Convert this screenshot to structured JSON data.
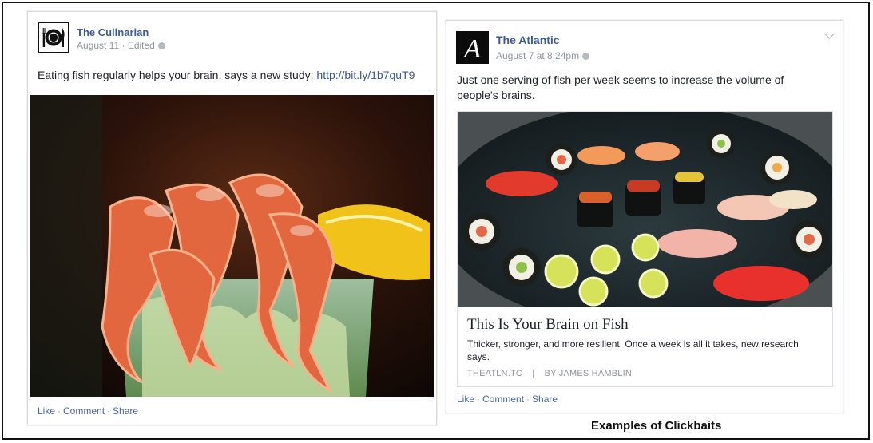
{
  "caption": "Examples of Clickbaits",
  "posts": [
    {
      "page_name": "The Culinarian",
      "date": "August 11",
      "edited": "Edited",
      "status_text": "Eating fish regularly helps your brain, says a new study: ",
      "status_link": "http://bit.ly/1b7quT9",
      "actions": [
        "Like",
        "Comment",
        "Share"
      ],
      "avatar_icon": "plate-fork-knife-icon"
    },
    {
      "page_name": "The Atlantic",
      "date": "August 7 at 8:24pm",
      "status_text": "Just one serving of fish per week seems to increase the volume of people's brains.",
      "link_card": {
        "title": "This Is Your Brain on Fish",
        "description": "Thicker, stronger, and more resilient. Once a week is all it takes, new research says.",
        "source": "THEATLN.TC",
        "separator": "|",
        "byline": "BY JAMES HAMBLIN"
      },
      "actions": [
        "Like",
        "Comment",
        "Share"
      ],
      "avatar_letter": "A"
    }
  ],
  "colors": {
    "link_blue": "#3b5998",
    "meta_gray": "#90949c",
    "border": "#d7d9df"
  }
}
